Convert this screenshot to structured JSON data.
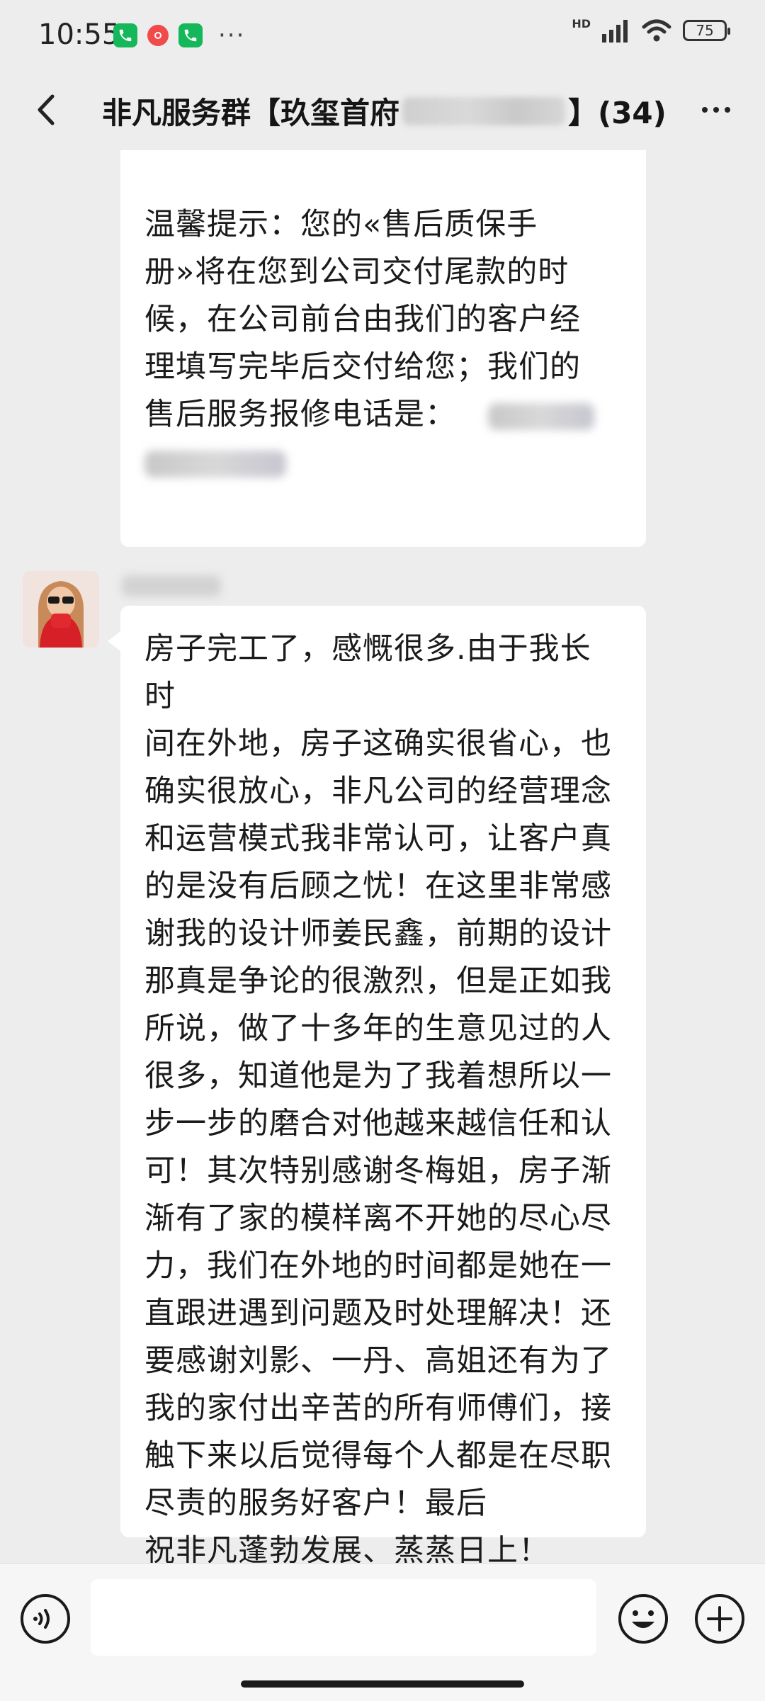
{
  "status_bar": {
    "time": "10:55",
    "hd": "HD",
    "battery": "75",
    "more": "···"
  },
  "header": {
    "title_prefix": "非凡服务群【玖玺首府",
    "member_count": "】(34)"
  },
  "messages": [
    {
      "lines": [
        "温馨提示：您的«售后质保手",
        "册»将在您到公司交付尾款的时",
        "候，在公司前台由我们的客户经",
        "理填写完毕后交付给您；我们的",
        "售后服务报修电话是："
      ]
    },
    {
      "lines": [
        "房子完工了，感慨很多.由于我长时",
        "间在外地，房子这确实很省心，也",
        "确实很放心，非凡公司的经营理念",
        "和运营模式我非常认可，让客户真",
        "的是没有后顾之忧！在这里非常感",
        "谢我的设计师姜民鑫，前期的设计",
        "那真是争论的很激烈，但是正如我",
        "所说，做了十多年的生意见过的人",
        "很多，知道他是为了我着想所以一",
        "步一步的磨合对他越来越信任和认",
        "可！其次特别感谢冬梅姐，房子渐",
        "渐有了家的模样离不开她的尽心尽",
        "力，我们在外地的时间都是她在一",
        "直跟进遇到问题及时处理解决！还",
        "要感谢刘影、一丹、高姐还有为了",
        "我的家付出辛苦的所有师傅们，接",
        "触下来以后觉得每个人都是在尽职",
        "尽责的服务好客户！最后",
        "祝非凡蓬勃发展、蒸蒸日上！"
      ]
    }
  ],
  "input": {
    "value": ""
  },
  "colors": {
    "background": "#ededed",
    "bubble": "#ffffff",
    "app_green": "#14b85a",
    "recording_red": "#f14a4a"
  },
  "icons": [
    "phone-icon",
    "record-icon",
    "phone-icon",
    "signal-icon",
    "wifi-icon",
    "battery-icon",
    "back-icon",
    "more-icon",
    "voice-icon",
    "emoji-icon",
    "plus-icon"
  ]
}
